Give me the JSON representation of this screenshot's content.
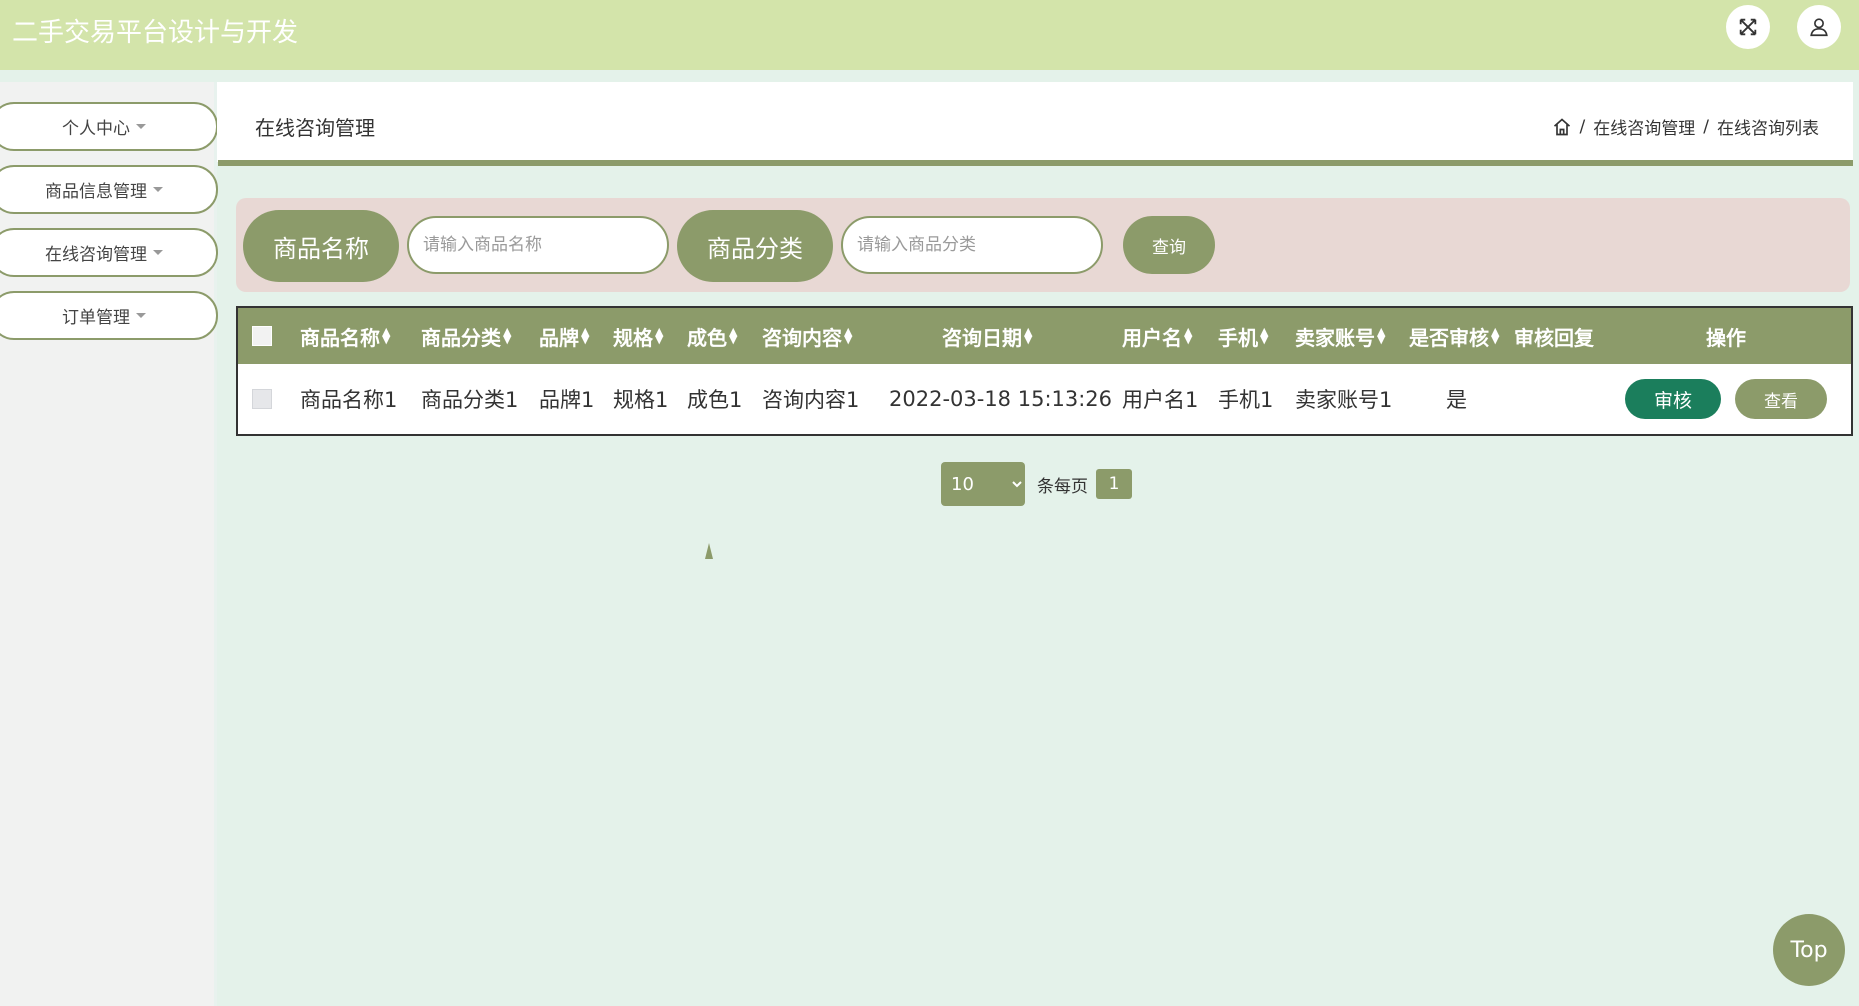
{
  "header": {
    "app_title": "二手交易平台设计与开发",
    "fullscreen_icon": "fullscreen-icon",
    "user_icon": "user-icon"
  },
  "sidebar": {
    "items": [
      {
        "label": "个人中心"
      },
      {
        "label": "商品信息管理"
      },
      {
        "label": "在线咨询管理"
      },
      {
        "label": "订单管理"
      }
    ]
  },
  "page": {
    "title": "在线咨询管理",
    "breadcrumb": [
      "在线咨询管理",
      "在线咨询列表"
    ],
    "home_icon": "home-icon"
  },
  "search": {
    "name_label": "商品名称",
    "name_placeholder": "请输入商品名称",
    "category_label": "商品分类",
    "category_placeholder": "请输入商品分类",
    "query_button": "查询"
  },
  "table": {
    "columns": [
      "商品名称",
      "商品分类",
      "品牌",
      "规格",
      "成色",
      "咨询内容",
      "咨询日期",
      "用户名",
      "手机",
      "卖家账号",
      "是否审核",
      "审核回复",
      "操作"
    ],
    "rows": [
      {
        "name": "商品名称1",
        "category": "商品分类1",
        "brand": "品牌1",
        "spec": "规格1",
        "condition": "成色1",
        "content": "咨询内容1",
        "date": "2022-03-18 15:13:26",
        "username": "用户名1",
        "phone": "手机1",
        "seller": "卖家账号1",
        "audited": "是",
        "reply": "",
        "audit_button": "审核",
        "view_button": "查看"
      }
    ]
  },
  "pagination": {
    "page_size": "10",
    "per_page_label": "条每页",
    "current_page": "1"
  },
  "top_button": "Top",
  "colors": {
    "header_bg": "#d3e4aa",
    "accent": "#8c9b6a",
    "audit_button": "#1b7e5c",
    "search_bg": "#e8d8d4",
    "page_bg": "#e4f2ea"
  }
}
